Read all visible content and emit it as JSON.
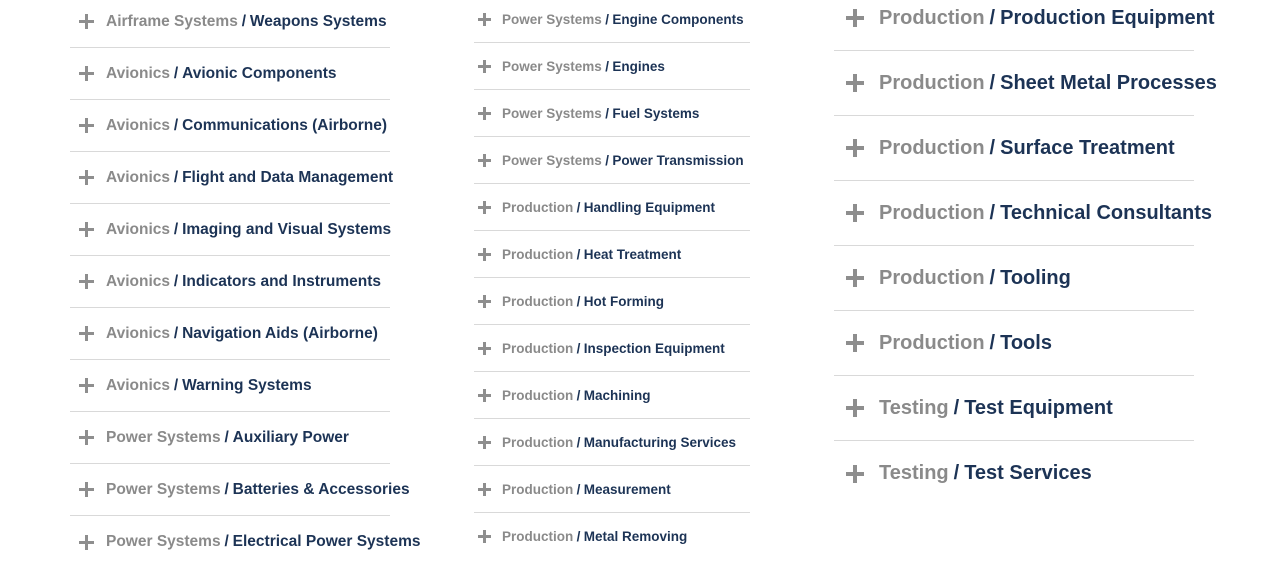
{
  "separator": "/",
  "colors": {
    "category": "#8a8a8a",
    "subcategory": "#1c3355",
    "divider": "#d9d9d9",
    "plus_icon": "#8e8e8e"
  },
  "columns": [
    {
      "items": [
        {
          "category": "Airframe Systems",
          "sub": "Weapons Systems"
        },
        {
          "category": "Avionics",
          "sub": "Avionic Components"
        },
        {
          "category": "Avionics",
          "sub": "Communications (Airborne)"
        },
        {
          "category": "Avionics",
          "sub": "Flight and Data Management"
        },
        {
          "category": "Avionics",
          "sub": "Imaging and Visual Systems"
        },
        {
          "category": "Avionics",
          "sub": "Indicators and Instruments"
        },
        {
          "category": "Avionics",
          "sub": "Navigation Aids (Airborne)"
        },
        {
          "category": "Avionics",
          "sub": "Warning Systems"
        },
        {
          "category": "Power Systems",
          "sub": "Auxiliary Power"
        },
        {
          "category": "Power Systems",
          "sub": "Batteries & Accessories"
        },
        {
          "category": "Power Systems",
          "sub": "Electrical Power Systems"
        }
      ]
    },
    {
      "items": [
        {
          "category": "Power Systems",
          "sub": "Engine Components"
        },
        {
          "category": "Power Systems",
          "sub": "Engines"
        },
        {
          "category": "Power Systems",
          "sub": "Fuel Systems"
        },
        {
          "category": "Power Systems",
          "sub": "Power Transmission"
        },
        {
          "category": "Production",
          "sub": "Handling Equipment"
        },
        {
          "category": "Production",
          "sub": "Heat Treatment"
        },
        {
          "category": "Production",
          "sub": "Hot Forming"
        },
        {
          "category": "Production",
          "sub": "Inspection Equipment"
        },
        {
          "category": "Production",
          "sub": "Machining"
        },
        {
          "category": "Production",
          "sub": "Manufacturing Services"
        },
        {
          "category": "Production",
          "sub": "Measurement"
        },
        {
          "category": "Production",
          "sub": "Metal Removing"
        }
      ]
    },
    {
      "items": [
        {
          "category": "Production",
          "sub": "Production Equipment"
        },
        {
          "category": "Production",
          "sub": "Sheet Metal Processes"
        },
        {
          "category": "Production",
          "sub": "Surface Treatment"
        },
        {
          "category": "Production",
          "sub": "Technical Consultants"
        },
        {
          "category": "Production",
          "sub": "Tooling"
        },
        {
          "category": "Production",
          "sub": "Tools"
        },
        {
          "category": "Testing",
          "sub": "Test Equipment"
        },
        {
          "category": "Testing",
          "sub": "Test Services"
        }
      ]
    }
  ]
}
